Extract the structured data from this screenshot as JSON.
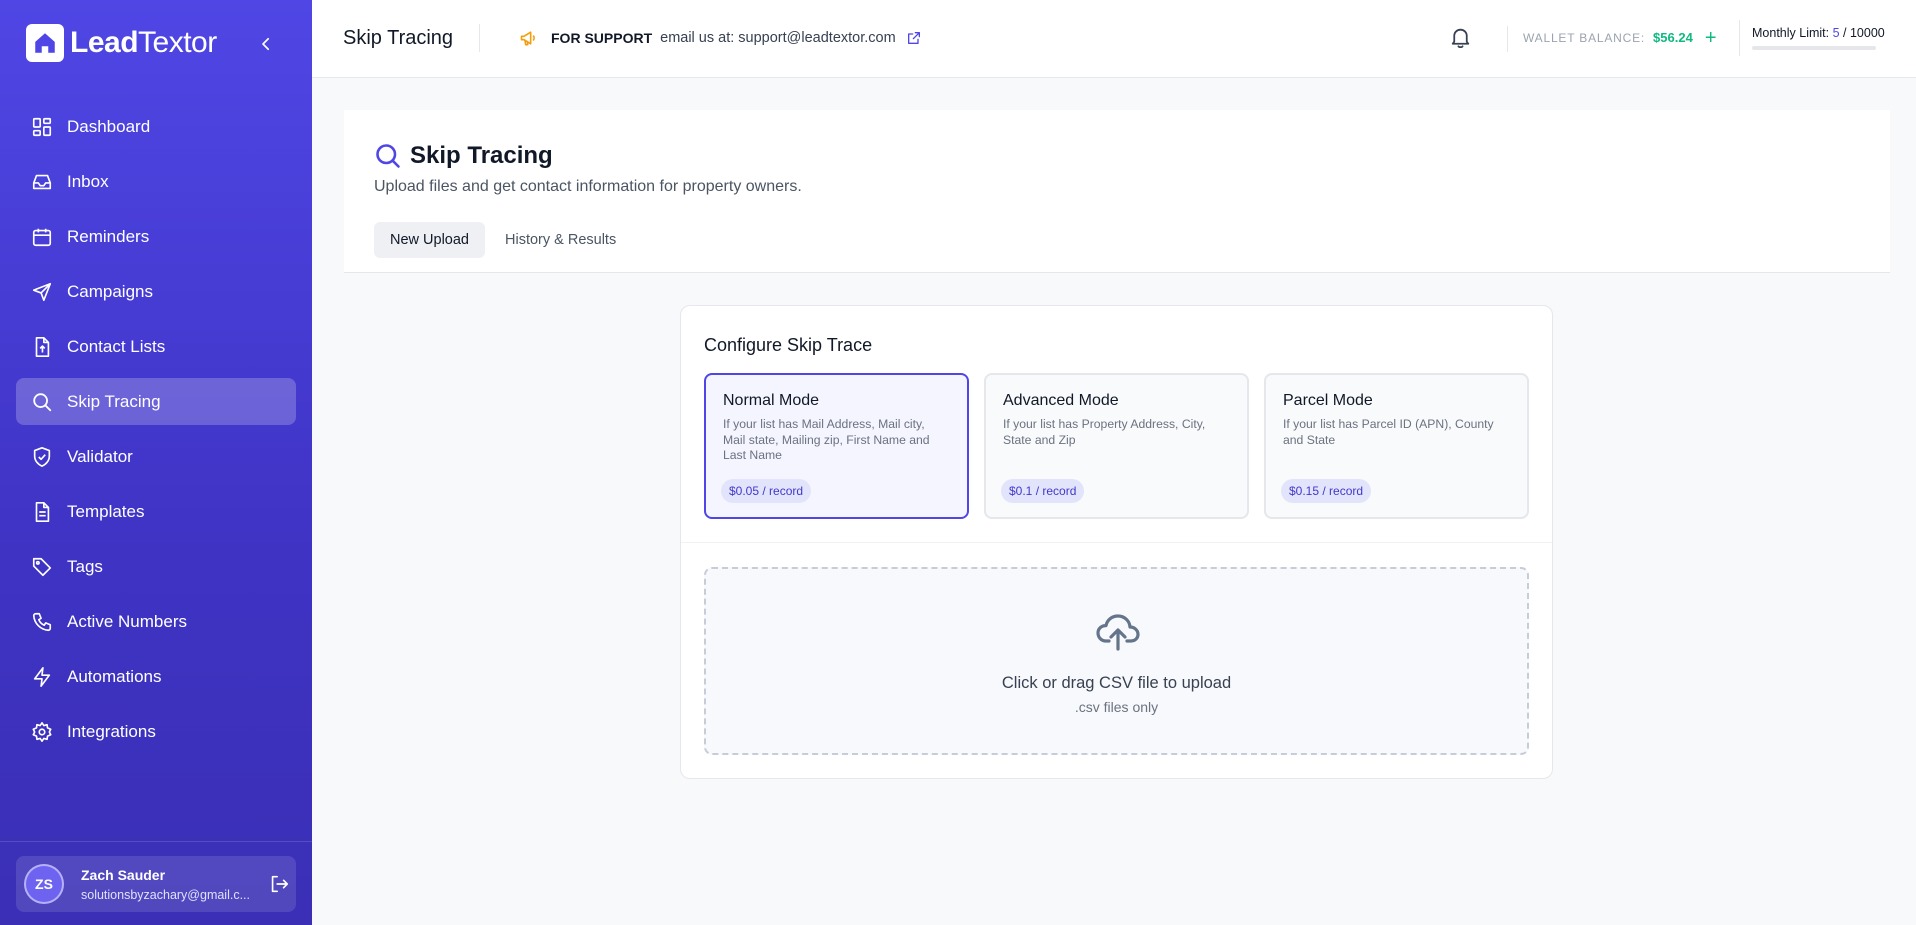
{
  "brand": {
    "name_bold": "Lead",
    "name_light": "Textor"
  },
  "sidebar": {
    "items": [
      {
        "label": "Dashboard",
        "icon": "dashboard-icon"
      },
      {
        "label": "Inbox",
        "icon": "inbox-icon"
      },
      {
        "label": "Reminders",
        "icon": "calendar-icon"
      },
      {
        "label": "Campaigns",
        "icon": "send-icon"
      },
      {
        "label": "Contact Lists",
        "icon": "file-upload-icon"
      },
      {
        "label": "Skip Tracing",
        "icon": "search-icon",
        "active": true
      },
      {
        "label": "Validator",
        "icon": "shield-check-icon"
      },
      {
        "label": "Templates",
        "icon": "document-icon"
      },
      {
        "label": "Tags",
        "icon": "tag-icon"
      },
      {
        "label": "Active Numbers",
        "icon": "phone-icon"
      },
      {
        "label": "Automations",
        "icon": "lightning-icon"
      },
      {
        "label": "Integrations",
        "icon": "gear-icon"
      }
    ],
    "user": {
      "initials": "ZS",
      "name": "Zach Sauder",
      "email": "solutionsbyzachary@gmail.c..."
    }
  },
  "header": {
    "title": "Skip Tracing",
    "support_label": "FOR SUPPORT",
    "support_text": "email us at: support@leadtextor.com",
    "wallet_label": "WALLET BALANCE:",
    "wallet_amount": "$56.24",
    "wallet_add": "+",
    "limit_label": "Monthly Limit:",
    "limit_used": "5",
    "limit_separator": " / ",
    "limit_total": "10000",
    "limit_fraction": 0.0005
  },
  "page": {
    "title": "Skip Tracing",
    "subtitle": "Upload files and get contact information for property owners.",
    "tabs": [
      {
        "label": "New Upload",
        "active": true
      },
      {
        "label": "History & Results",
        "active": false
      }
    ]
  },
  "config": {
    "title": "Configure Skip Trace",
    "modes": [
      {
        "name": "Normal Mode",
        "desc": "If your list has Mail Address, Mail city, Mail state, Mailing zip, First Name and Last Name",
        "price": "$0.05 / record",
        "selected": true
      },
      {
        "name": "Advanced Mode",
        "desc": "If your list has Property Address, City, State and Zip",
        "price": "$0.1 / record",
        "selected": false
      },
      {
        "name": "Parcel Mode",
        "desc": "If your list has Parcel ID (APN), County and State",
        "price": "$0.15 / record",
        "selected": false
      }
    ],
    "upload": {
      "title": "Click or drag CSV file to upload",
      "subtitle": ".csv files only"
    }
  },
  "colors": {
    "primary": "#4f46e5",
    "success": "#10b981",
    "accent": "#f59e0b"
  }
}
